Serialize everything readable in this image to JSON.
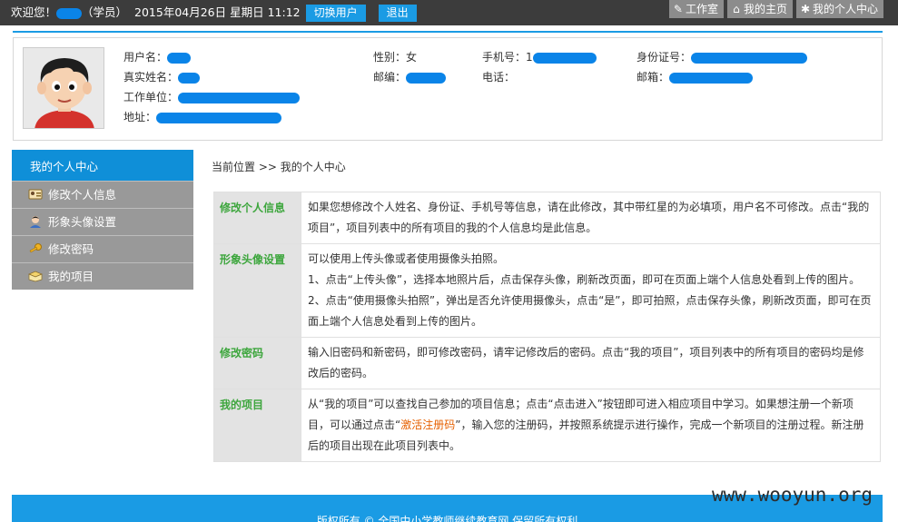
{
  "topbar": {
    "welcome": "欢迎您！",
    "role": "（学员）",
    "datetime": "2015年04月26日 星期日 11:12",
    "switch_user": "切换用户",
    "logout": "退出",
    "workroom": "工作室",
    "home": "我的主页",
    "personal_center": "我的个人中心"
  },
  "profile": {
    "username_label": "用户名：",
    "realname_label": "真实姓名：",
    "work_unit_label": "工作单位：",
    "address_label": "地址：",
    "gender_label": "性别：女",
    "postcode_label": "邮编：",
    "mobile_label": "手机号：",
    "mobile_partial": "1",
    "phone_label": "电话：",
    "idcard_label": "身份证号：",
    "email_label": "邮箱："
  },
  "sidebar": {
    "header": "我的个人中心",
    "items": [
      {
        "label": "修改个人信息",
        "icon": "id-card-icon"
      },
      {
        "label": "形象头像设置",
        "icon": "user-avatar-icon"
      },
      {
        "label": "修改密码",
        "icon": "key-icon"
      },
      {
        "label": "我的项目",
        "icon": "project-icon"
      }
    ]
  },
  "breadcrumb": "当前位置 >> 我的个人中心",
  "help": [
    {
      "title": "修改个人信息",
      "text": "如果您想修改个人姓名、身份证、手机号等信息，请在此修改，其中带红星的为必填项，用户名不可修改。点击“我的项目”，项目列表中的所有项目的我的个人信息均是此信息。"
    },
    {
      "title": "形象头像设置",
      "line1": "可以使用上传头像或者使用摄像头拍照。",
      "line2": "1、点击“上传头像”，选择本地照片后，点击保存头像，刷新改页面，即可在页面上端个人信息处看到上传的图片。",
      "line3": "2、点击“使用摄像头拍照”，弹出是否允许使用摄像头，点击“是”，即可拍照，点击保存头像，刷新改页面，即可在页面上端个人信息处看到上传的图片。"
    },
    {
      "title": "修改密码",
      "text": "输入旧密码和新密码，即可修改密码，请牢记修改后的密码。点击“我的项目”，项目列表中的所有项目的密码均是修改后的密码。"
    },
    {
      "title": "我的项目",
      "text_before": "从“我的项目”可以查找自己参加的项目信息；点击“点击进入”按钮即可进入相应项目中学习。如果想注册一个新项目，可以通过点击“",
      "link": "激活注册码",
      "text_after": "”，输入您的注册码，并按照系统提示进行操作，完成一个新项目的注册过程。新注册后的项目出现在此项目列表中。"
    }
  ],
  "footer": "版权所有 © 全国中小学教师继续教育网 保留所有权利",
  "watermark": "www.wooyun.org",
  "colors": {
    "accent": "#1a9be4",
    "sidebar_head": "#0f8fd8",
    "help_title": "#3da63d",
    "link": "#e66000"
  }
}
